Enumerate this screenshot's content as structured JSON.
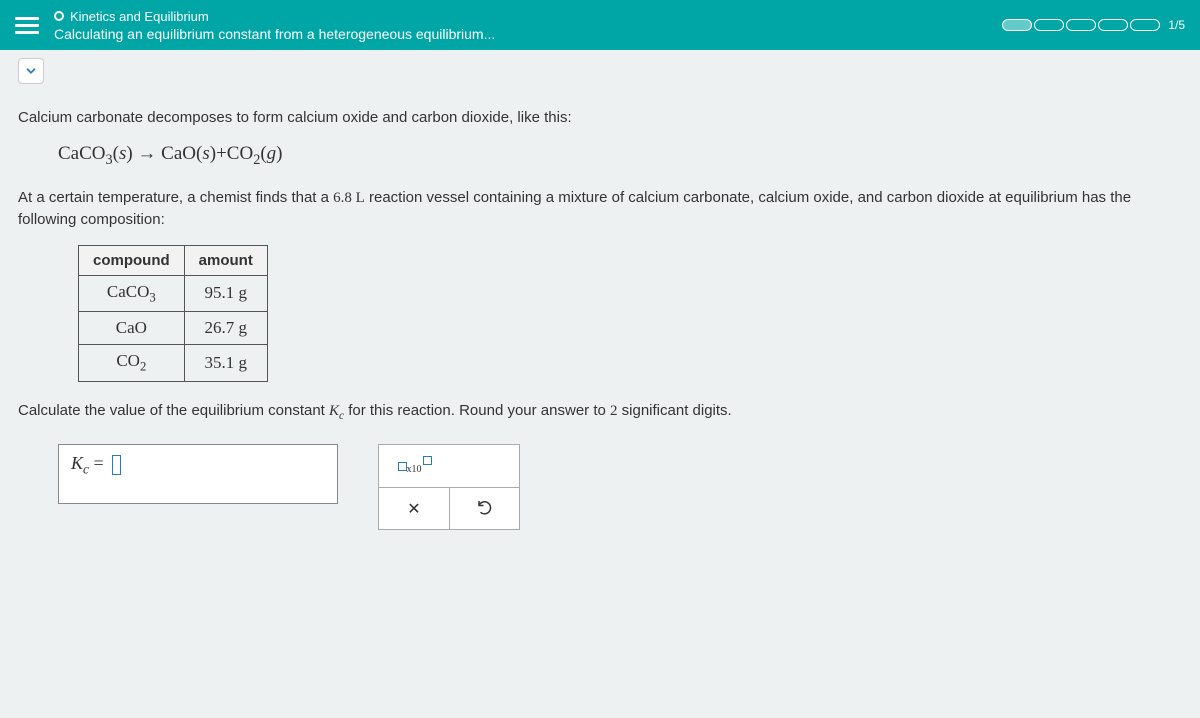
{
  "header": {
    "topic": "Kinetics and Equilibrium",
    "subtitle": "Calculating an equilibrium constant from a heterogeneous equilibrium...",
    "progress_label": "1/5"
  },
  "problem": {
    "intro": "Calcium carbonate decomposes to form calcium oxide and carbon dioxide, like this:",
    "setup1": "At a certain temperature, a chemist finds that a ",
    "volume": "6.8 L",
    "setup2": " reaction vessel containing a mixture of calcium carbonate, calcium oxide, and carbon dioxide at equilibrium has the following composition:",
    "table": {
      "head_compound": "compound",
      "head_amount": "amount",
      "rows": [
        {
          "compound_html": "CaCO<sub>3</sub>",
          "amount": "95.1 g"
        },
        {
          "compound_html": "CaO",
          "amount": "26.7 g"
        },
        {
          "compound_html": "CO<sub>2</sub>",
          "amount": "35.1 g"
        }
      ]
    },
    "question1": "Calculate the value of the equilibrium constant ",
    "question2": " for this reaction. Round your answer to ",
    "sigfigs": "2",
    "question3": " significant digits."
  },
  "answer": {
    "label_html": "K<sub style='font-style:italic'>c</sub> = "
  },
  "tools": {
    "sci_label": "x10"
  }
}
